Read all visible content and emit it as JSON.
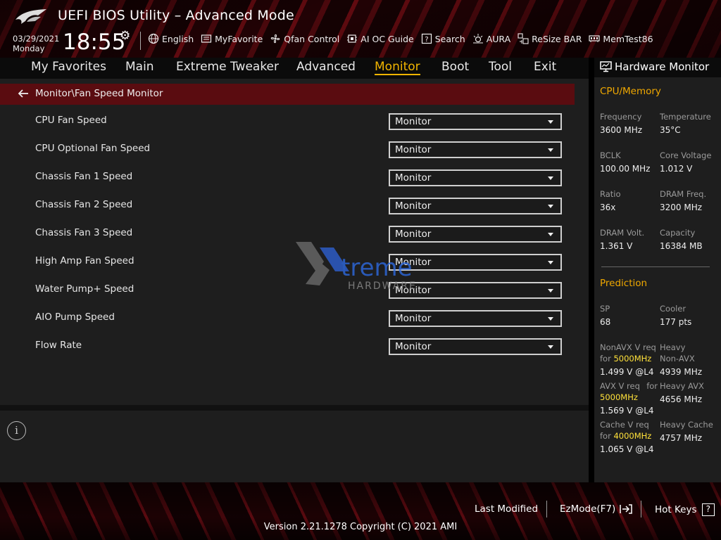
{
  "header": {
    "title": "UEFI BIOS Utility – Advanced Mode",
    "date": "03/29/2021",
    "day": "Monday",
    "time": "18:55",
    "tools": [
      {
        "label": "English",
        "icon": "globe-icon"
      },
      {
        "label": "MyFavorite",
        "icon": "favorite-icon"
      },
      {
        "label": "Qfan Control",
        "icon": "fan-icon"
      },
      {
        "label": "AI OC Guide",
        "icon": "ai-oc-icon"
      },
      {
        "label": "Search",
        "icon": "search-help-icon"
      },
      {
        "label": "AURA",
        "icon": "aura-icon"
      },
      {
        "label": "ReSize BAR",
        "icon": "resize-bar-icon"
      },
      {
        "label": "MemTest86",
        "icon": "memtest-icon"
      }
    ]
  },
  "menu": {
    "items": [
      "My Favorites",
      "Main",
      "Extreme Tweaker",
      "Advanced",
      "Monitor",
      "Boot",
      "Tool",
      "Exit"
    ],
    "active": "Monitor"
  },
  "breadcrumb": "Monitor\\Fan Speed Monitor",
  "settings": [
    {
      "label": "CPU Fan Speed",
      "value": "Monitor"
    },
    {
      "label": "CPU Optional Fan Speed",
      "value": "Monitor"
    },
    {
      "label": "Chassis Fan 1 Speed",
      "value": "Monitor"
    },
    {
      "label": "Chassis Fan 2 Speed",
      "value": "Monitor"
    },
    {
      "label": "Chassis Fan 3 Speed",
      "value": "Monitor"
    },
    {
      "label": "High Amp Fan Speed",
      "value": "Monitor"
    },
    {
      "label": "Water Pump+ Speed",
      "value": "Monitor"
    },
    {
      "label": "AIO Pump Speed",
      "value": "Monitor"
    },
    {
      "label": "Flow Rate",
      "value": "Monitor"
    }
  ],
  "watermark": {
    "line1": "treme",
    "line2": "HARDWARE"
  },
  "hw": {
    "title": "Hardware Monitor",
    "cpu_section": "CPU/Memory",
    "cpu": [
      {
        "label": "Frequency",
        "value": "3600 MHz"
      },
      {
        "label": "Temperature",
        "value": "35°C"
      },
      {
        "label": "BCLK",
        "value": "100.00 MHz"
      },
      {
        "label": "Core Voltage",
        "value": "1.012 V"
      },
      {
        "label": "Ratio",
        "value": "36x"
      },
      {
        "label": "DRAM Freq.",
        "value": "3200 MHz"
      },
      {
        "label": "DRAM Volt.",
        "value": "1.361 V"
      },
      {
        "label": "Capacity",
        "value": "16384 MB"
      }
    ],
    "pred_section": "Prediction",
    "sp_label": "SP",
    "sp_value": "68",
    "cooler_label": "Cooler",
    "cooler_value": "177 pts",
    "nonavx_l1": "NonAVX V req",
    "nonavx_for": "for",
    "nonavx_mhz": "5000MHz",
    "nonavx_value": "1.499 V @L4",
    "heavy_nonavx_l1": "Heavy",
    "heavy_nonavx_l2": "Non-AVX",
    "heavy_nonavx_value": "4939 MHz",
    "avx_l1": "AVX V req",
    "avx_for": "for",
    "avx_mhz": "5000MHz",
    "avx_value": "1.569 V @L4",
    "heavy_avx_label": "Heavy AVX",
    "heavy_avx_value": "4656 MHz",
    "cache_l1": "Cache V req",
    "cache_for": "for",
    "cache_mhz": "4000MHz",
    "cache_value": "1.065 V @L4",
    "heavy_cache_label": "Heavy Cache",
    "heavy_cache_value": "4757 MHz"
  },
  "footer": {
    "last_modified": "Last Modified",
    "ezmode": "EzMode(F7)",
    "hotkeys": "Hot Keys",
    "hotkeys_icon": "?",
    "version": "Version 2.21.1278 Copyright (C) 2021 AMI"
  },
  "colors": {
    "accent": "#f0b400",
    "highlight": "#ffe13a",
    "breadcrumb_bg": "#5a0c10"
  }
}
